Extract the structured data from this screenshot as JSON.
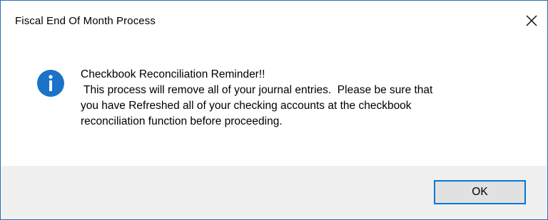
{
  "window": {
    "title": "Fiscal End Of Month Process",
    "close_icon": "close-icon"
  },
  "message": {
    "icon": "info-icon",
    "icon_color": "#1a73c8",
    "lines": [
      "Checkbook Reconciliation Reminder!!",
      " This process will remove all of your journal entries.  Please be sure that",
      "you have Refreshed all of your checking accounts at the checkbook",
      "reconciliation function before proceeding."
    ]
  },
  "buttons": {
    "ok_label": "OK",
    "focus_color": "#0078d7"
  }
}
